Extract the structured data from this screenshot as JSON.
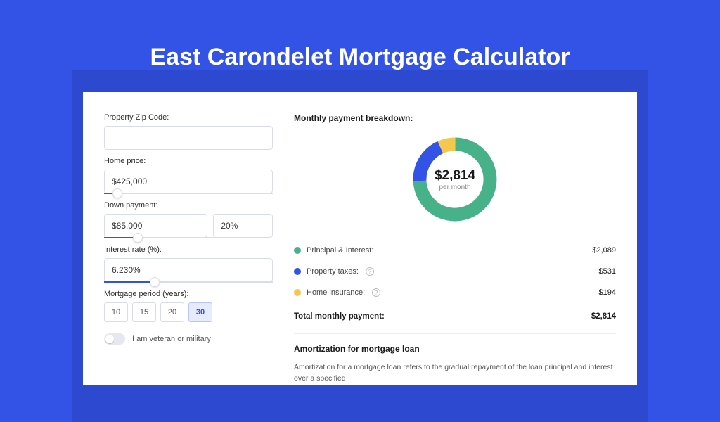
{
  "title": "East Carondelet Mortgage Calculator",
  "form": {
    "zip": {
      "label": "Property Zip Code:",
      "value": ""
    },
    "home_price": {
      "label": "Home price:",
      "value": "$425,000",
      "slider_pct": 8
    },
    "down_payment": {
      "label": "Down payment:",
      "value": "$85,000",
      "pct_value": "20%",
      "slider_pct": 20
    },
    "interest_rate": {
      "label": "Interest rate (%):",
      "value": "6.230%",
      "slider_pct": 30
    },
    "period": {
      "label": "Mortgage period (years):",
      "options": [
        "10",
        "15",
        "20",
        "30"
      ],
      "selected": "30"
    },
    "veteran": {
      "label": "I am veteran or military",
      "checked": false
    }
  },
  "breakdown": {
    "title": "Monthly payment breakdown:",
    "center_amount": "$2,814",
    "center_sub": "per month",
    "items": [
      {
        "label": "Principal & Interest:",
        "value": "$2,089",
        "color": "#47b28a",
        "info": false
      },
      {
        "label": "Property taxes:",
        "value": "$531",
        "color": "#3353e6",
        "info": true
      },
      {
        "label": "Home insurance:",
        "value": "$194",
        "color": "#f4c84d",
        "info": true
      }
    ],
    "total_label": "Total monthly payment:",
    "total_value": "$2,814"
  },
  "chart_data": {
    "type": "pie",
    "title": "Monthly payment breakdown",
    "series": [
      {
        "name": "Principal & Interest",
        "value": 2089,
        "color": "#47b28a"
      },
      {
        "name": "Property taxes",
        "value": 531,
        "color": "#3353e6"
      },
      {
        "name": "Home insurance",
        "value": 194,
        "color": "#f4c84d"
      }
    ],
    "total": 2814,
    "center_label": "$2,814 per month"
  },
  "amortization": {
    "title": "Amortization for mortgage loan",
    "body": "Amortization for a mortgage loan refers to the gradual repayment of the loan principal and interest over a specified"
  }
}
